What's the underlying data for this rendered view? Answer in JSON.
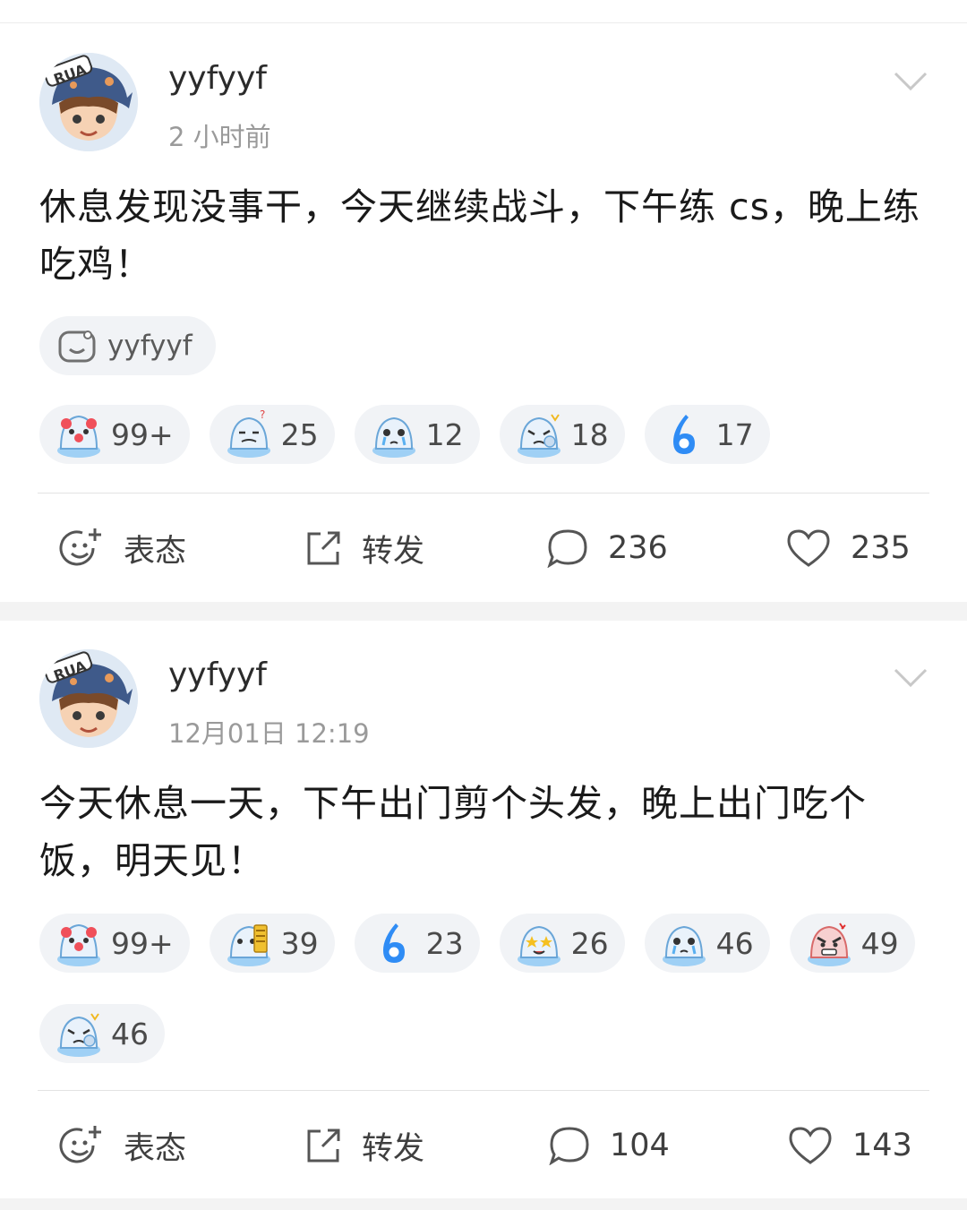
{
  "posts": [
    {
      "username": "yyfyyf",
      "time": "2 小时前",
      "text": "休息发现没事干，今天继续战斗，下午练 cs，晚上练吃鸡！",
      "tag": "yyfyyf",
      "reactions": [
        {
          "icon": "clown-icon",
          "count": "99+"
        },
        {
          "icon": "sad-ghost-icon",
          "count": "25"
        },
        {
          "icon": "crying-ghost-icon",
          "count": "12"
        },
        {
          "icon": "facepalm-ghost-icon",
          "count": "18"
        },
        {
          "icon": "six-icon",
          "count": "17"
        }
      ],
      "actions": {
        "react": "表态",
        "repost": "转发",
        "comments": "236",
        "likes": "235"
      }
    },
    {
      "username": "yyfyyf",
      "time": "12月01日 12:19",
      "text": "今天休息一天，下午出门剪个头发，晚上出门吃个饭，明天见！",
      "reactions": [
        {
          "icon": "clown-icon",
          "count": "99+"
        },
        {
          "icon": "reading-ghost-icon",
          "count": "39"
        },
        {
          "icon": "six-icon",
          "count": "23"
        },
        {
          "icon": "star-eyes-ghost-icon",
          "count": "26"
        },
        {
          "icon": "crying-ghost-icon",
          "count": "46"
        },
        {
          "icon": "angry-ghost-icon",
          "count": "49"
        },
        {
          "icon": "facepalm-ghost-icon",
          "count": "46"
        }
      ],
      "actions": {
        "react": "表态",
        "repost": "转发",
        "comments": "104",
        "likes": "143"
      }
    }
  ],
  "colors": {
    "accent": "#2f8cf5",
    "text": "#1a1a1a",
    "muted": "#9a9a9a",
    "pill": "#f1f3f6"
  }
}
